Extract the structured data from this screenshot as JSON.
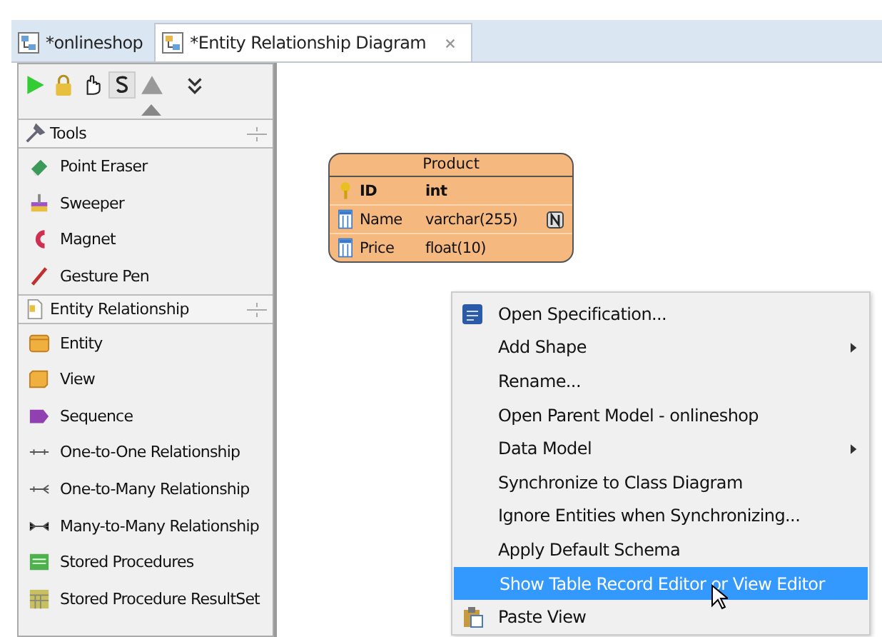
{
  "tabs": [
    {
      "label": "*onlineshop",
      "selected": false,
      "closable": false
    },
    {
      "label": "*Entity Relationship Diagram",
      "selected": true,
      "closable": true
    }
  ],
  "palette": {
    "groups": [
      {
        "title": "Tools",
        "items": [
          {
            "label": "Point Eraser"
          },
          {
            "label": "Sweeper"
          },
          {
            "label": "Magnet"
          },
          {
            "label": "Gesture Pen"
          }
        ]
      },
      {
        "title": "Entity Relationship",
        "items": [
          {
            "label": "Entity"
          },
          {
            "label": "View"
          },
          {
            "label": "Sequence"
          },
          {
            "label": "One-to-One Relationship"
          },
          {
            "label": "One-to-Many Relationship"
          },
          {
            "label": "Many-to-Many Relationship"
          },
          {
            "label": "Stored Procedures"
          },
          {
            "label": "Stored Procedure ResultSet"
          }
        ]
      }
    ]
  },
  "entity": {
    "name": "Product",
    "columns": [
      {
        "name": "ID",
        "type": "int",
        "primary_key": true,
        "nullable": false
      },
      {
        "name": "Name",
        "type": "varchar(255)",
        "primary_key": false,
        "nullable": true
      },
      {
        "name": "Price",
        "type": "float(10)",
        "primary_key": false,
        "nullable": false
      }
    ]
  },
  "context_menu": [
    {
      "label": "Open Specification...",
      "submenu": false,
      "selected": false
    },
    {
      "label": "Add Shape",
      "submenu": true,
      "selected": false
    },
    {
      "label": "Rename...",
      "submenu": false,
      "selected": false
    },
    {
      "label": "Open Parent Model - onlineshop",
      "submenu": false,
      "selected": false
    },
    {
      "label": "Data Model",
      "submenu": true,
      "selected": false
    },
    {
      "label": "Synchronize to Class Diagram",
      "submenu": false,
      "selected": false
    },
    {
      "label": "Ignore Entities when Synchronizing...",
      "submenu": false,
      "selected": false
    },
    {
      "label": "Apply Default Schema",
      "submenu": false,
      "selected": false
    },
    {
      "label": "Show Table Record Editor or View Editor",
      "submenu": false,
      "selected": true
    },
    {
      "label": "Paste View",
      "submenu": false,
      "selected": false
    }
  ]
}
